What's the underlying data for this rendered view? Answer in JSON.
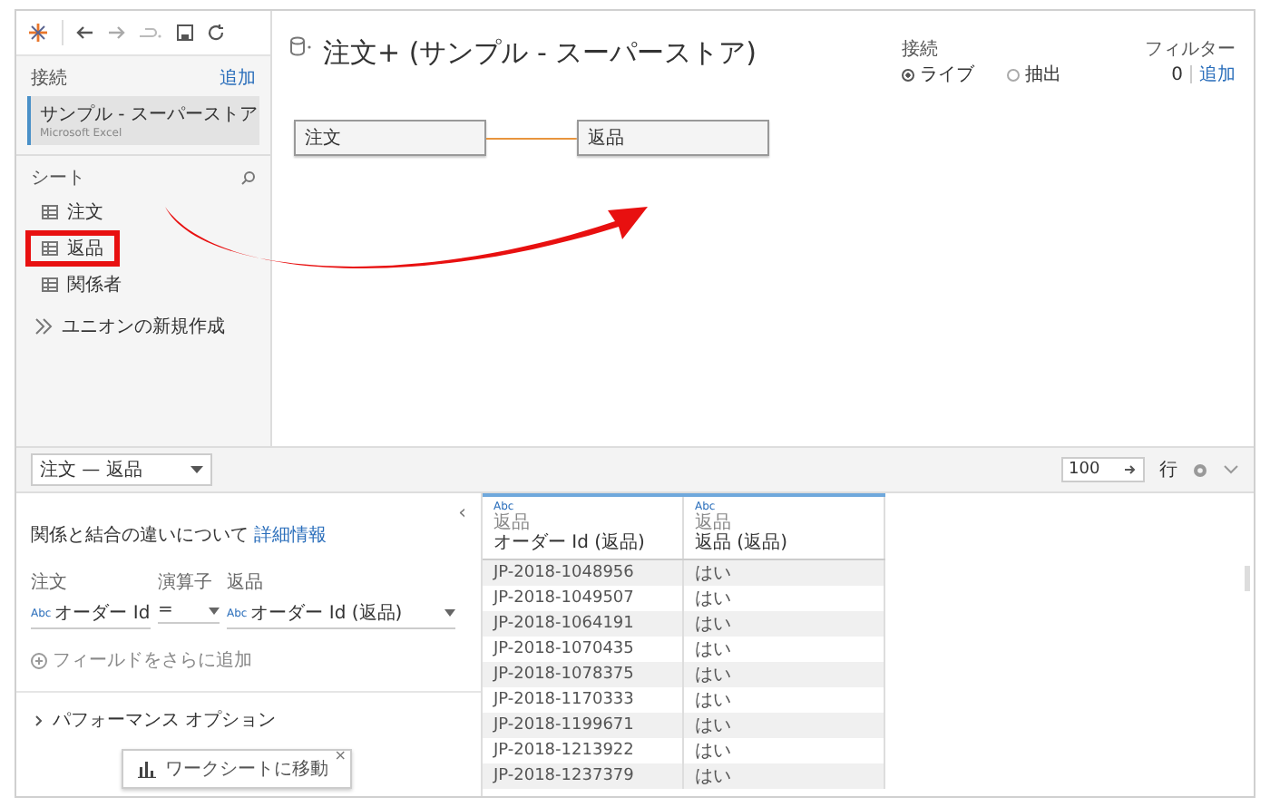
{
  "sidebar": {
    "connections_label": "接続",
    "add_link": "追加",
    "connection": {
      "name": "サンプル - スーパーストア",
      "type": "Microsoft Excel"
    },
    "sheets_label": "シート",
    "sheets": [
      {
        "name": "注文",
        "highlighted": false
      },
      {
        "name": "返品",
        "highlighted": true
      },
      {
        "name": "関係者",
        "highlighted": false
      }
    ],
    "new_union": "ユニオンの新規作成"
  },
  "header": {
    "title": "注文+ (サンプル - スーパーストア)",
    "connection_label": "接続",
    "connection_modes": [
      {
        "label": "ライブ",
        "selected": true
      },
      {
        "label": "抽出",
        "selected": false
      }
    ],
    "filter_label": "フィルター",
    "filter_count": "0",
    "filter_add": "追加"
  },
  "canvas": {
    "tables": [
      "注文",
      "返品"
    ]
  },
  "bottom_toolbar": {
    "relationship_select": "注文 — 返品",
    "rows_value": "100",
    "rows_label": "行"
  },
  "join_panel": {
    "info_text": "関係と結合の違いについて",
    "info_link": "詳細情報",
    "collapse": "‹",
    "column_headers": [
      "注文",
      "演算子",
      "返品"
    ],
    "clause": [
      {
        "type_tag": "Abc",
        "field": "オーダー Id"
      },
      {
        "field": "="
      },
      {
        "type_tag": "Abc",
        "field": "オーダー Id (返品)"
      }
    ],
    "add_field": "フィールドをさらに追加",
    "performance": "パフォーマンス オプション"
  },
  "grid": {
    "columns": [
      {
        "type_tag": "Abc",
        "source": "返品",
        "name": "オーダー Id (返品)"
      },
      {
        "type_tag": "Abc",
        "source": "返品",
        "name": "返品 (返品)"
      }
    ],
    "rows": [
      [
        "JP-2018-1048956",
        "はい"
      ],
      [
        "JP-2018-1049507",
        "はい"
      ],
      [
        "JP-2018-1064191",
        "はい"
      ],
      [
        "JP-2018-1070435",
        "はい"
      ],
      [
        "JP-2018-1078375",
        "はい"
      ],
      [
        "JP-2018-1170333",
        "はい"
      ],
      [
        "JP-2018-1199671",
        "はい"
      ],
      [
        "JP-2018-1213922",
        "はい"
      ],
      [
        "JP-2018-1237379",
        "はい"
      ]
    ]
  },
  "tooltip": {
    "text": "ワークシートに移動",
    "close": "×"
  }
}
